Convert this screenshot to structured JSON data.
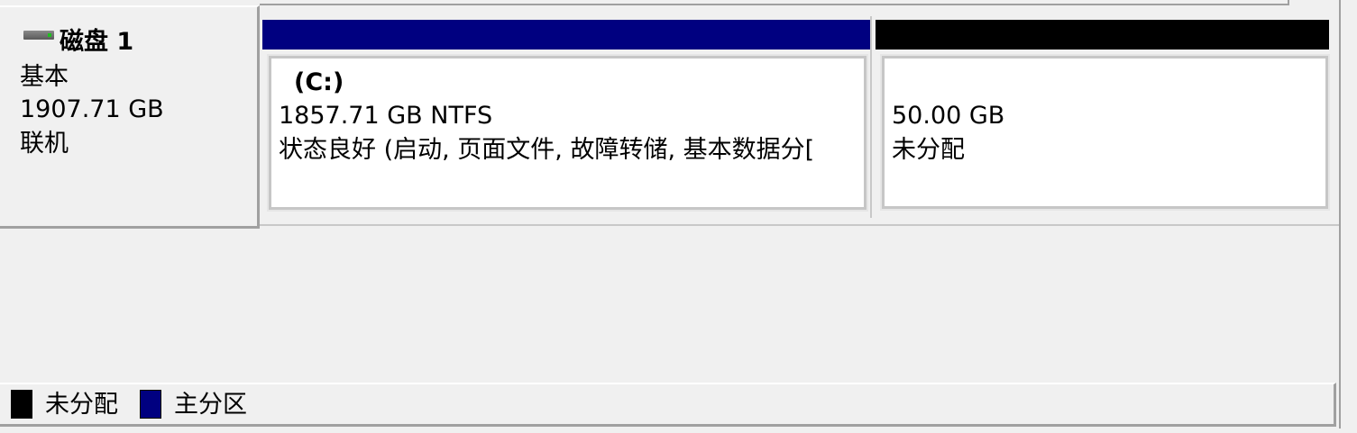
{
  "disk": {
    "name": "磁盘 1",
    "type": "基本",
    "size": "1907.71 GB",
    "status": "联机"
  },
  "partitions": [
    {
      "label": "(C:)",
      "size_fs": "1857.71 GB NTFS",
      "status": "状态良好 (启动, 页面文件, 故障转储, 基本数据分[",
      "bar_color": "#000080"
    },
    {
      "size": "50.00 GB",
      "status": "未分配",
      "bar_color": "#000000"
    }
  ],
  "legend": [
    {
      "label": "未分配",
      "color": "#000000"
    },
    {
      "label": "主分区",
      "color": "#000080"
    }
  ]
}
